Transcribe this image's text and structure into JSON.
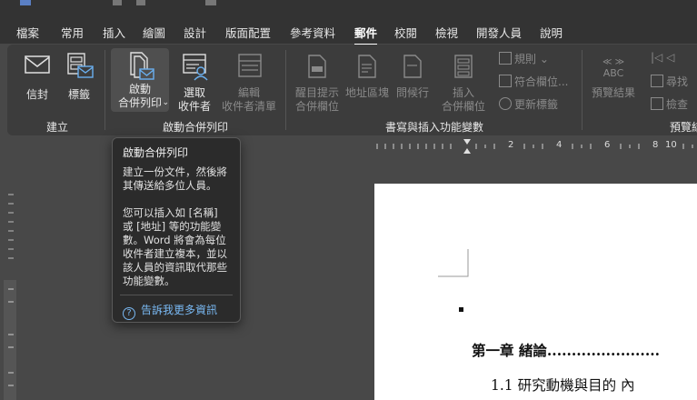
{
  "tabs": [
    "檔案",
    "常用",
    "插入",
    "繪圖",
    "設計",
    "版面配置",
    "參考資料",
    "郵件",
    "校閱",
    "檢視",
    "開發人員",
    "說明"
  ],
  "active_tab": "郵件",
  "ribbon": {
    "create": {
      "envelope": "信封",
      "labels": "標籤",
      "group": "建立"
    },
    "start": {
      "start_merge_1": "啟動",
      "start_merge_2": "合併列印",
      "select_1": "選取",
      "select_2": "收件者",
      "edit_1": "編輯",
      "edit_2": "收件者清單",
      "group": "啟動合併列印"
    },
    "write": {
      "highlight_1": "醒目提示",
      "highlight_2": "合併欄位",
      "address_block": "地址區塊",
      "greeting_line": "問候行",
      "insert_1": "插入",
      "insert_2": "合併欄位",
      "rules": "規則",
      "match_fields": "符合欄位...",
      "update_labels": "更新標籤",
      "group": "書寫與插入功能變數"
    },
    "preview": {
      "abc": "ABC",
      "preview_results": "預覽結果",
      "find": "尋找",
      "check": "檢查",
      "group": "預覽結"
    }
  },
  "tooltip": {
    "title": "啟動合併列印",
    "p1": [
      "建立一份文件，然後將",
      "其傳送給多位人員。"
    ],
    "p2": [
      "您可以插入如 [名稱]",
      "或 [地址] 等的功能變",
      "數。Word 將會為每位",
      "收件者建立複本，並以",
      "該人員的資訊取代那些",
      "功能變數。"
    ],
    "link": "告訴我更多資訊"
  },
  "ruler": [
    "2",
    "4",
    "6",
    "8",
    "10"
  ],
  "document": {
    "heading": "第一章  緒論.......................",
    "subheading": "1.1  研究動機與目的      內"
  }
}
